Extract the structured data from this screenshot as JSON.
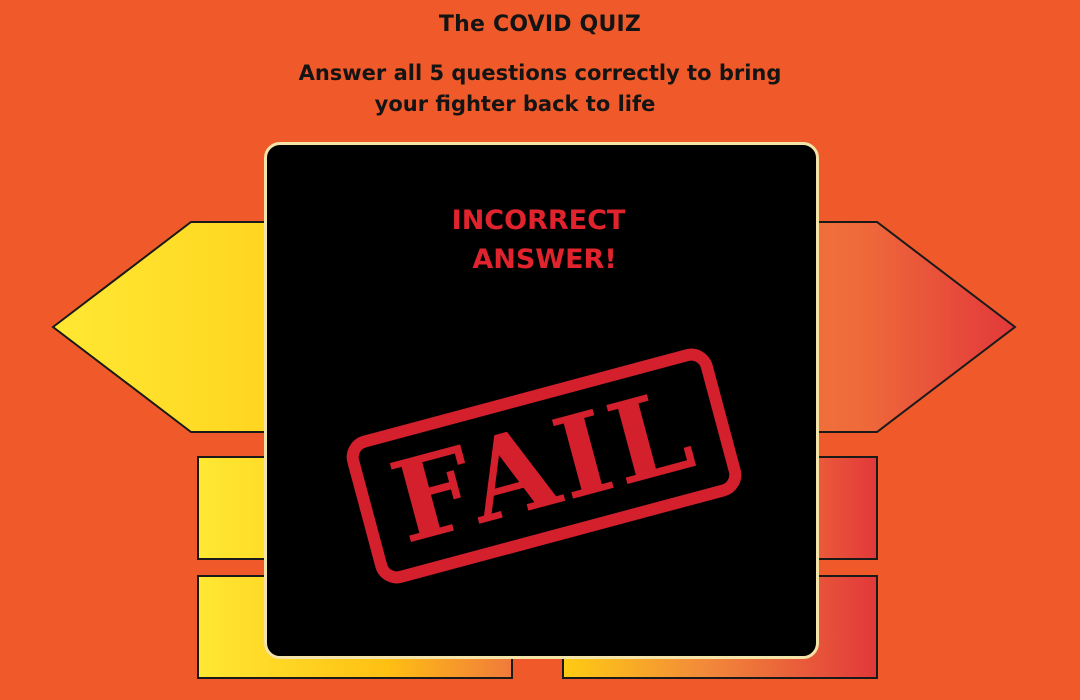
{
  "header": {
    "title": "The COVID QUIZ",
    "instructions_line1": "Answer all 5 questions correctly to bring",
    "instructions_line2": "your fighter back to life"
  },
  "feedback": {
    "result_line1": "INCORRECT",
    "result_line2": "ANSWER!",
    "stamp_text": "FAIL"
  },
  "colors": {
    "background": "#f05a2a",
    "modal_background": "#000000",
    "modal_border": "#f3e3a8",
    "incorrect_text": "#e0232d",
    "stamp_red": "#d41f2d",
    "option_yellow": "#ffe833",
    "option_gold": "#ffcc12",
    "option_orange": "#f07a3c",
    "option_red": "#e2383a"
  }
}
